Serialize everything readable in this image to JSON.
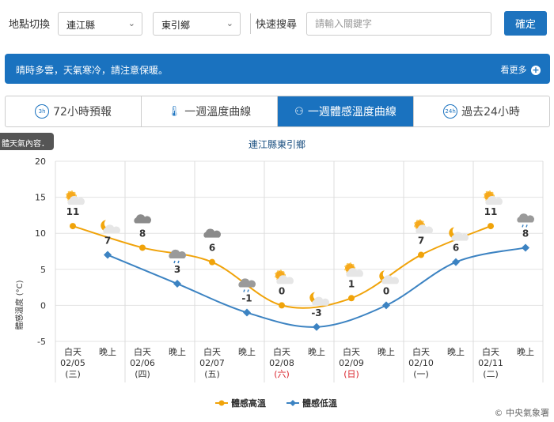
{
  "location": {
    "label": "地點切換",
    "county": "連江縣",
    "town": "東引鄉",
    "quick_search_label": "快速搜尋",
    "search_placeholder": "請輸入關鍵字",
    "confirm_label": "確定"
  },
  "banner": {
    "message": "晴時多雲，天氣寒冷，請注意保暖。",
    "more_label": "看更多"
  },
  "tabs": [
    {
      "icon": "3h",
      "label": "72小時預報",
      "active": false
    },
    {
      "icon": "thermometer-icon",
      "label": "一週溫度曲線",
      "active": false
    },
    {
      "icon": "body-temp-icon",
      "label": "一週體感溫度曲線",
      "active": true
    },
    {
      "icon": "24h",
      "label": "過去24小時",
      "active": false
    }
  ],
  "tooltip_chip": "體天氣內容．",
  "colors": {
    "accent": "#1a72bf",
    "high": "#f0a30a",
    "low": "#3c83c2",
    "sunday": "#d9232b"
  },
  "chart_data": {
    "type": "line",
    "title": "連江縣東引鄉",
    "ylabel": "體感溫度 (°C)",
    "ylim": [
      -5,
      20
    ],
    "yticks": [
      20,
      15,
      10,
      5,
      0,
      -5
    ],
    "grid": true,
    "legend_position": "bottom",
    "days": [
      {
        "date": "02/05",
        "weekday": "(三)",
        "holiday": false
      },
      {
        "date": "02/06",
        "weekday": "(四)",
        "holiday": false
      },
      {
        "date": "02/07",
        "weekday": "(五)",
        "holiday": false
      },
      {
        "date": "02/08",
        "weekday": "(六)",
        "holiday": true
      },
      {
        "date": "02/09",
        "weekday": "(日)",
        "holiday": true
      },
      {
        "date": "02/10",
        "weekday": "(一)",
        "holiday": false
      },
      {
        "date": "02/11",
        "weekday": "(二)",
        "holiday": false
      }
    ],
    "day_label": "白天",
    "night_label": "晚上",
    "series": [
      {
        "name": "體感高溫",
        "values": [
          11,
          8,
          6,
          0,
          1,
          7,
          11
        ],
        "icons": [
          "sunny-cloud",
          "cloudy",
          "cloudy",
          "sunny-cloud",
          "sunny-cloud",
          "sunny-cloud",
          "sunny-cloud"
        ]
      },
      {
        "name": "體感低溫",
        "values": [
          7,
          3,
          -1,
          -3,
          0,
          6,
          8
        ],
        "icons": [
          "moon-cloud",
          "rainy-cloud",
          "rainy-cloud",
          "moon-cloud",
          "moon-cloud",
          "moon-cloud",
          "rainy-cloud"
        ]
      }
    ],
    "credit": "© 中央氣象署"
  }
}
